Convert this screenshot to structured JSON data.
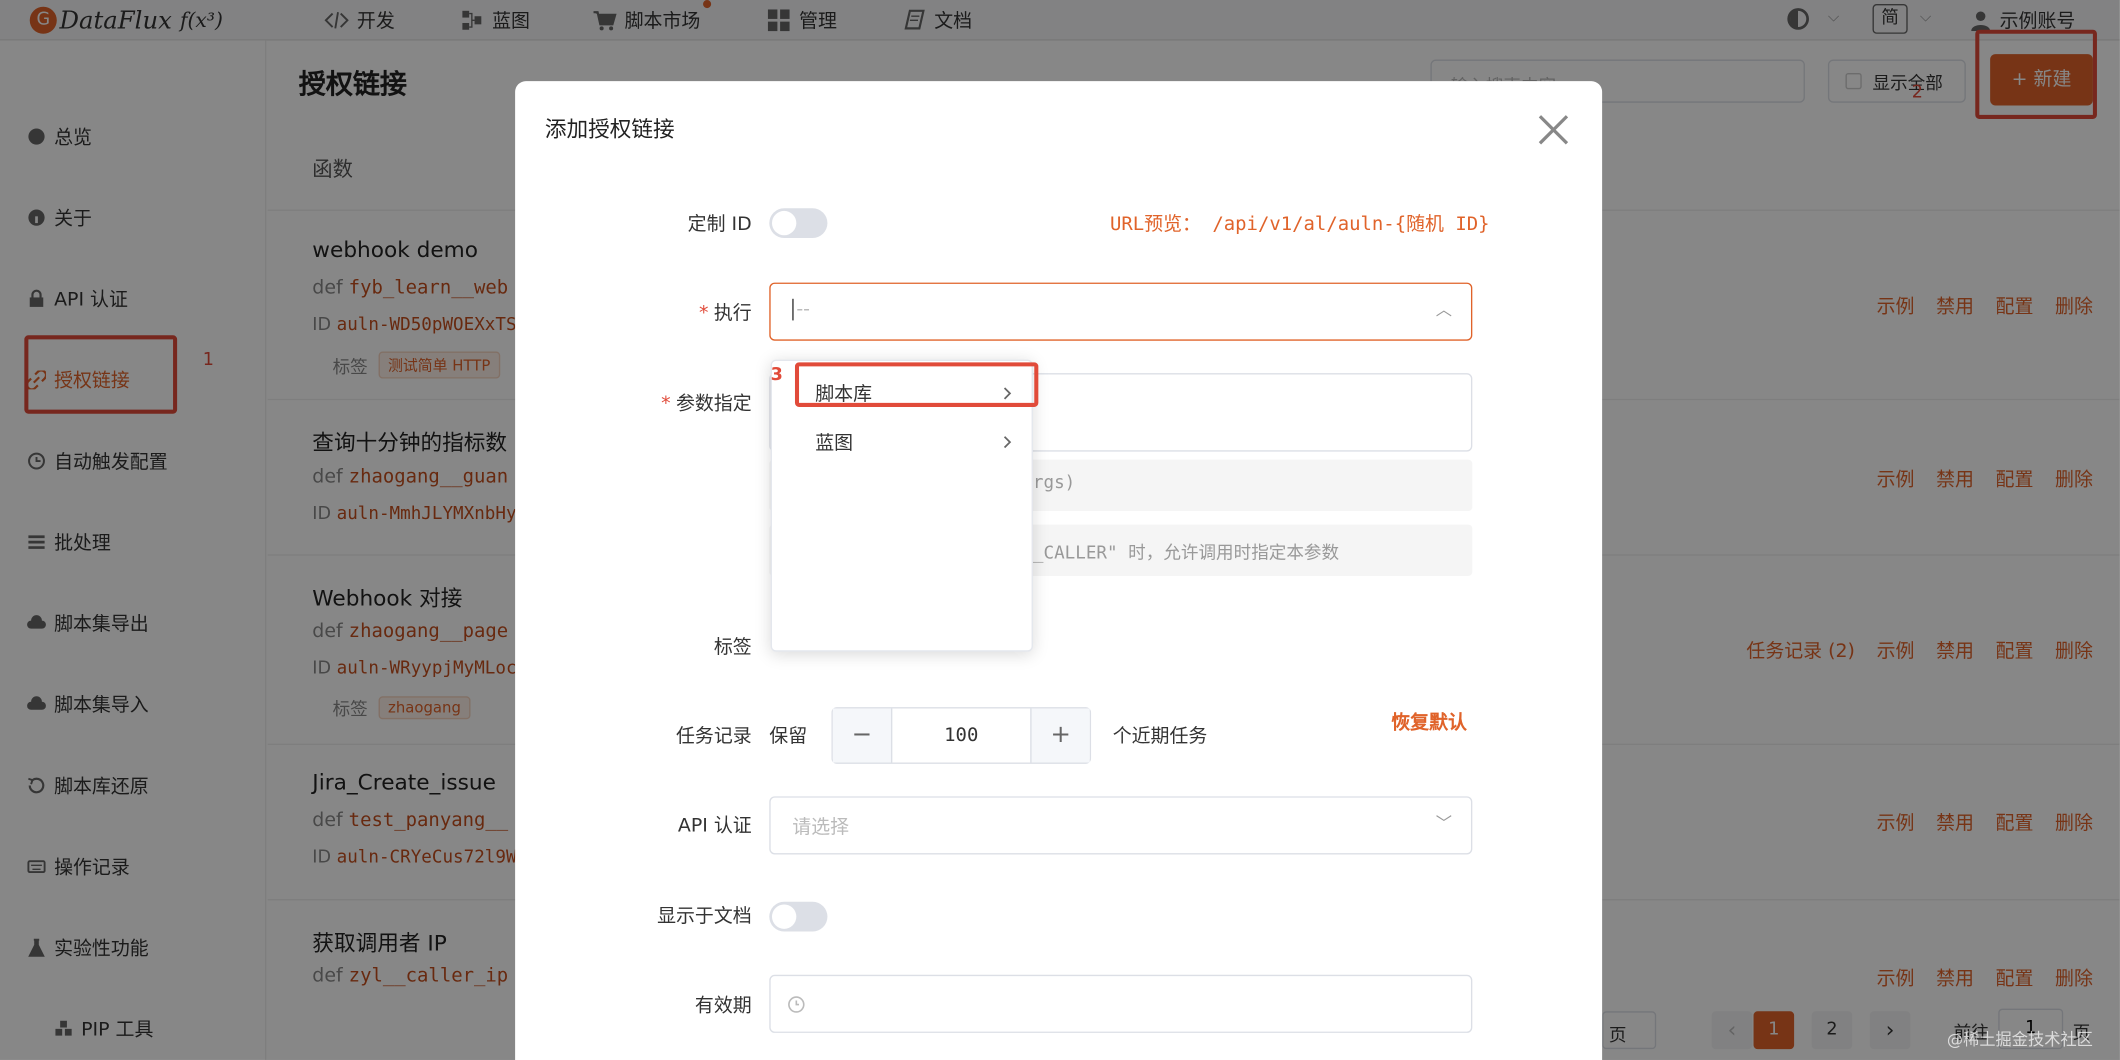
{
  "header": {
    "logo_text": "DataFlux",
    "logo_suffix": "f(x³)",
    "nav": [
      "开发",
      "蓝图",
      "脚本市场",
      "管理",
      "文档"
    ],
    "lang": "简",
    "account": "示例账号"
  },
  "sidebar": {
    "items": [
      "总览",
      "关于",
      "API 认证",
      "授权链接",
      "自动触发配置",
      "批处理",
      "脚本集导出",
      "脚本集导入",
      "脚本库还原",
      "操作记录",
      "实验性功能",
      "PIP 工具"
    ],
    "active": "授权链接"
  },
  "page": {
    "title": "授权链接",
    "search_placeholder": "输入搜索内容",
    "show_all_label": "显示全部",
    "new_button": "+ 新建",
    "column_header": "函数"
  },
  "functions": [
    {
      "title": "webhook demo",
      "def_prefix": "def",
      "def": "fyb_learn__web",
      "id_label": "ID",
      "id": "auln-WD50pWOEXxTS",
      "tag_label": "标签",
      "tag": "测试简单 HTTP",
      "actions": [
        "示例",
        "禁用",
        "配置",
        "删除"
      ]
    },
    {
      "title": "查询十分钟的指标数",
      "def_prefix": "def",
      "def": "zhaogang__guan",
      "id_label": "ID",
      "id": "auln-MmhJLYMXnbHy",
      "actions": [
        "示例",
        "禁用",
        "配置",
        "删除"
      ]
    },
    {
      "title": "Webhook 对接",
      "def_prefix": "def",
      "def": "zhaogang__page",
      "id_label": "ID",
      "id": "auln-WRyypjMyMLoc",
      "tag_label": "标签",
      "tag": "zhaogang",
      "actions": [
        "任务记录 (2)",
        "示例",
        "禁用",
        "配置",
        "删除"
      ]
    },
    {
      "title": "Jira_Create_issue",
      "def_prefix": "def",
      "def": "test_panyang__",
      "id_label": "ID",
      "id": "auln-CRYeCus72l9W",
      "actions": [
        "示例",
        "禁用",
        "配置",
        "删除"
      ]
    },
    {
      "title": "获取调用者 IP",
      "def_prefix": "def",
      "def": "zyl__caller_ip",
      "actions": [
        "示例",
        "禁用",
        "配置",
        "删除"
      ]
    }
  ],
  "pagination": {
    "pages": [
      "1",
      "2"
    ],
    "current": "1",
    "goto_label": "前往",
    "goto_value": "1",
    "page_suffix": "页"
  },
  "modal": {
    "title": "添加授权链接",
    "custom_id_label": "定制 ID",
    "url_preview": "URL预览： /api/v1/al/auln-{随机 ID}",
    "exec_label": "执行",
    "exec_placeholder": "--",
    "params_label": "参数指定",
    "params_hint1": "rgs)",
    "params_hint2": "_CALLER\" 时，允许调用时指定本参数",
    "tags_label": "标签",
    "task_label": "任务记录",
    "task_keep": "保留",
    "task_value": "100",
    "task_suffix": "个近期任务",
    "restore_default": "恢复默认",
    "api_label": "API 认证",
    "api_placeholder": "请选择",
    "doc_label": "显示于文档",
    "expire_label": "有效期"
  },
  "dropdown": {
    "items": [
      "脚本库",
      "蓝图"
    ]
  },
  "annotations": {
    "n1": "1",
    "n2": "2",
    "n3": "3"
  },
  "watermark": "@稀土掘金技术社区"
}
